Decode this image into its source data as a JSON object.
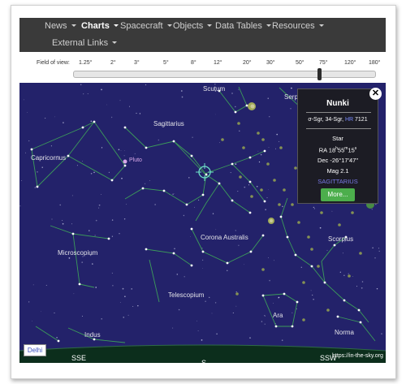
{
  "nav": {
    "items": [
      {
        "label": "News",
        "dropdown": true
      },
      {
        "label": "Charts",
        "dropdown": true,
        "active": true
      },
      {
        "label": "Spacecraft",
        "dropdown": true
      },
      {
        "label": "Objects",
        "dropdown": true
      },
      {
        "label": "Data Tables",
        "dropdown": true
      },
      {
        "label": "Resources",
        "dropdown": true
      },
      {
        "label": "External Links",
        "dropdown": true
      }
    ]
  },
  "fov": {
    "label": "Field of view:",
    "ticks": [
      "1.25°",
      "2°",
      "3°",
      "5°",
      "8°",
      "12°",
      "20°",
      "30°",
      "50°",
      "75°",
      "120°",
      "180°"
    ],
    "selected": "75°"
  },
  "sky": {
    "constellations": [
      "Scutum",
      "Serpens",
      "Sagittarius",
      "Capricornus",
      "Corona Australis",
      "Microscopium",
      "Telescopium",
      "Scorpius",
      "Ara",
      "Indus",
      "Norma"
    ],
    "planets": [
      "Pluto"
    ],
    "compass": [
      "SSE",
      "S",
      "SSW"
    ],
    "location": "Delhi",
    "credit": "https://in-the-sky.org"
  },
  "popup": {
    "close_icon": "close-icon",
    "name": "Nunki",
    "designation_pre": "σ-Sgr, 34-Sgr, ",
    "designation_hr_label": "HR",
    "designation_hr_number": " 7121",
    "type": "Star",
    "ra_h": "18",
    "ra_m": "55",
    "ra_s": "15",
    "dec_deg": "-26°",
    "dec_min": "17'",
    "dec_sec": "47\"",
    "magnitude": "Mag 2.1",
    "constellation": "SAGITTARIUS",
    "more_label": "More..."
  },
  "colors": {
    "sky": "#23226a",
    "constellation_lines": "#3c9c5a",
    "highlight_ring": "#6ee0c8",
    "nav_bg": "#3a3a3a",
    "more_button": "#4cae4c"
  }
}
